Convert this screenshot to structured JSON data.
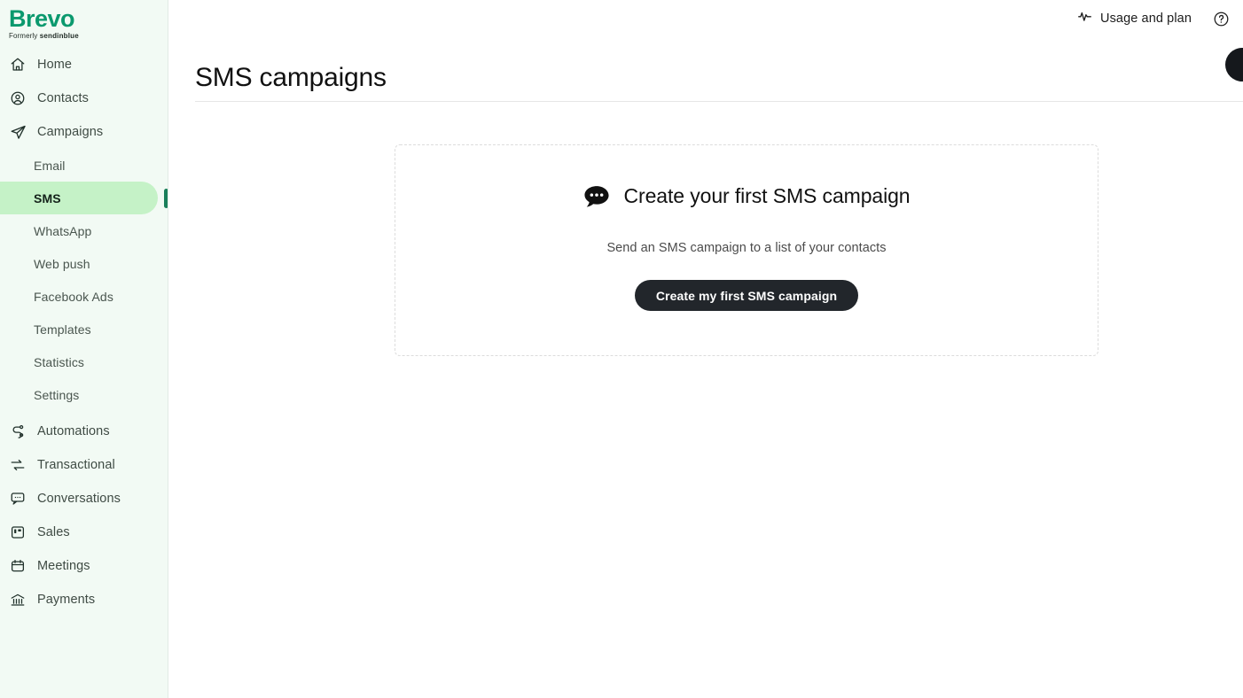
{
  "brand": {
    "logo_text": "Brevo",
    "logo_sub_prefix": "Formerly",
    "logo_sub_name": "sendinblue",
    "green": "#0b996e",
    "accent_bar": "#1a7f5a",
    "active_pill": "#c5f2c7",
    "sidebar_bg": "#f2faf4"
  },
  "sidebar": {
    "items": [
      {
        "label": "Home",
        "icon": "home-icon"
      },
      {
        "label": "Contacts",
        "icon": "contacts-icon"
      },
      {
        "label": "Campaigns",
        "icon": "campaigns-paper-plane-icon"
      },
      {
        "label": "Automations",
        "icon": "automations-icon"
      },
      {
        "label": "Transactional",
        "icon": "transactional-icon"
      },
      {
        "label": "Conversations",
        "icon": "conversations-icon"
      },
      {
        "label": "Sales",
        "icon": "sales-icon"
      },
      {
        "label": "Meetings",
        "icon": "meetings-calendar-icon"
      },
      {
        "label": "Payments",
        "icon": "payments-bank-icon"
      }
    ],
    "campaign_subitems": [
      {
        "label": "Email",
        "active": false
      },
      {
        "label": "SMS",
        "active": true
      },
      {
        "label": "WhatsApp",
        "active": false
      },
      {
        "label": "Web push",
        "active": false
      },
      {
        "label": "Facebook Ads",
        "active": false
      },
      {
        "label": "Templates",
        "active": false
      },
      {
        "label": "Statistics",
        "active": false
      },
      {
        "label": "Settings",
        "active": false
      }
    ]
  },
  "topbar": {
    "usage_and_plan": "Usage and plan",
    "usage_icon": "activity-pulse-icon",
    "help_icon": "help-circle-icon",
    "avatar": "user-avatar"
  },
  "header": {
    "title": "SMS campaigns"
  },
  "empty_state": {
    "icon": "chat-bubble-dots-icon",
    "title": "Create your first SMS campaign",
    "subtitle": "Send an SMS campaign to a list of your contacts",
    "button_label": "Create my first SMS campaign"
  }
}
